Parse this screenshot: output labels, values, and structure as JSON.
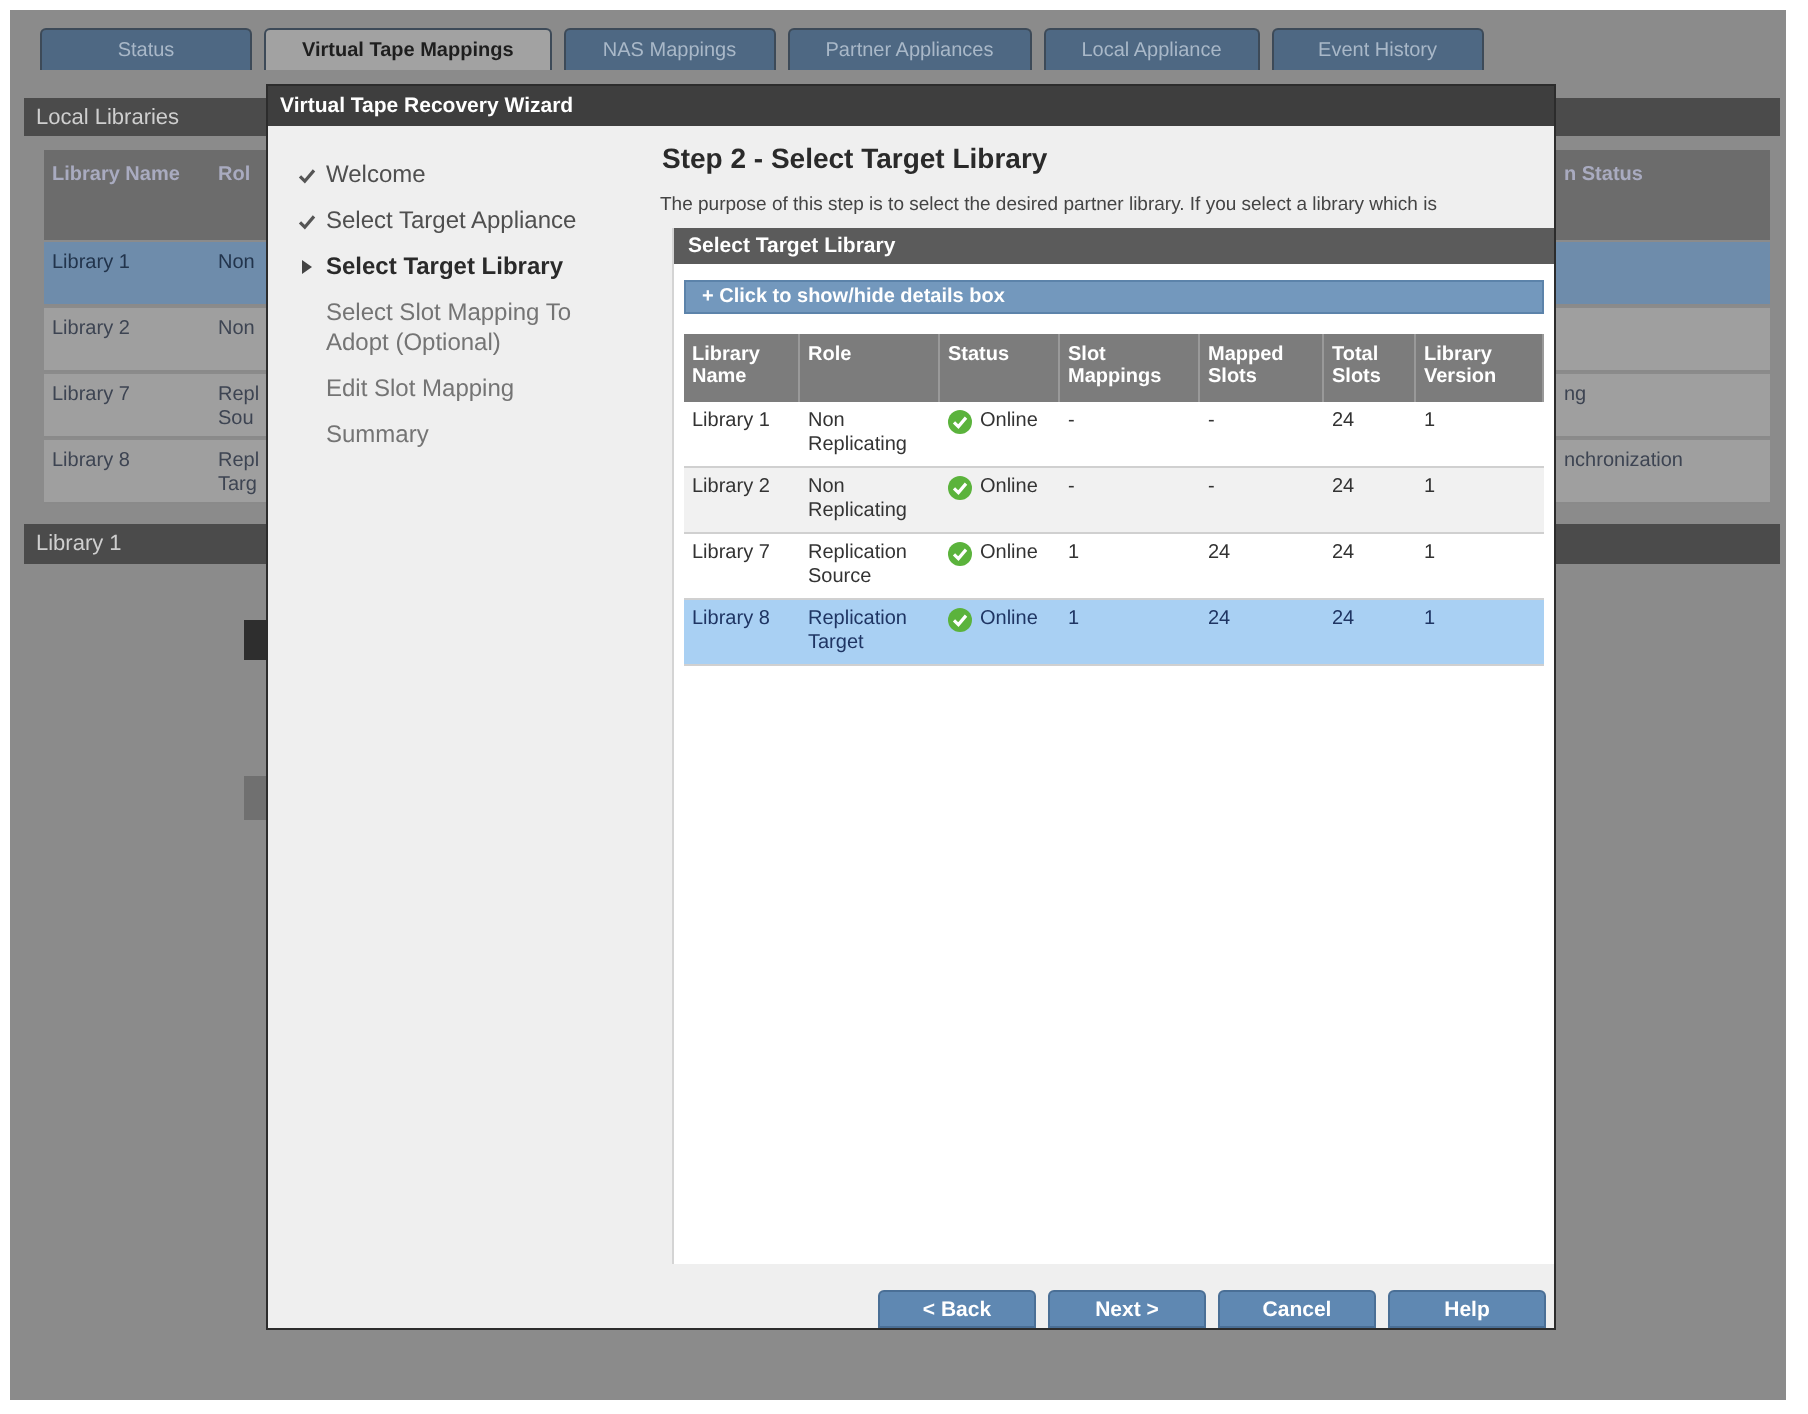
{
  "tabs": [
    {
      "label": "Status",
      "selected": false
    },
    {
      "label": "Virtual Tape Mappings",
      "selected": true
    },
    {
      "label": "NAS Mappings",
      "selected": false
    },
    {
      "label": "Partner Appliances",
      "selected": false
    },
    {
      "label": "Local Appliance",
      "selected": false
    },
    {
      "label": "Event History",
      "selected": false
    }
  ],
  "local_libraries": {
    "title": "Local Libraries",
    "columns": {
      "library_name": "Library Name",
      "role": "Rol",
      "column_right": "n Status"
    },
    "rows": [
      {
        "library_name": "Library 1",
        "role": "Non",
        "selected": true
      },
      {
        "library_name": "Library 2",
        "role": "Non",
        "selected": false
      },
      {
        "library_name": "Library 7",
        "role": "Repl Sou",
        "column_right": "ng",
        "selected": false
      },
      {
        "library_name": "Library 8",
        "role": "Repl Targ",
        "column_right": "nchronization",
        "selected": false
      }
    ]
  },
  "library_panel": {
    "title": "Library 1"
  },
  "wizard": {
    "title": "Virtual Tape Recovery Wizard",
    "steps": [
      {
        "label": "Welcome",
        "completed": true,
        "selected": false
      },
      {
        "label": "Select Target Appliance",
        "completed": true,
        "selected": false
      },
      {
        "label": "Select Target Library",
        "completed": false,
        "selected": true
      },
      {
        "label": "Select Slot Mapping To Adopt (Optional)",
        "completed": false,
        "selected": false
      },
      {
        "label": "Edit Slot Mapping",
        "completed": false,
        "selected": false
      },
      {
        "label": "Summary",
        "completed": false,
        "selected": false
      }
    ],
    "heading": "Step 2 - Select Target Library",
    "description": "The purpose of this step is to select the desired partner library. If you select a library which is",
    "panel": {
      "title": "Select Target Library",
      "toggle": "+ Click to show/hide details box",
      "columns": [
        "Library Name",
        "Role",
        "Status",
        "Slot Mappings",
        "Mapped Slots",
        "Total Slots",
        "Library Version"
      ],
      "rows": [
        {
          "library_name": "Library 1",
          "role": "Non Replicating",
          "status": "Online",
          "slot_mappings": "-",
          "mapped_slots": "-",
          "total_slots": "24",
          "library_version": "1",
          "selected": false
        },
        {
          "library_name": "Library 2",
          "role": "Non Replicating",
          "status": "Online",
          "slot_mappings": "-",
          "mapped_slots": "-",
          "total_slots": "24",
          "library_version": "1",
          "selected": false
        },
        {
          "library_name": "Library 7",
          "role": "Replication Source",
          "status": "Online",
          "slot_mappings": "1",
          "mapped_slots": "24",
          "total_slots": "24",
          "library_version": "1",
          "selected": false
        },
        {
          "library_name": "Library 8",
          "role": "Replication Target",
          "status": "Online",
          "slot_mappings": "1",
          "mapped_slots": "24",
          "total_slots": "24",
          "library_version": "1",
          "selected": true
        }
      ]
    },
    "buttons": [
      "< Back",
      "Next >",
      "Cancel",
      "Help"
    ]
  }
}
